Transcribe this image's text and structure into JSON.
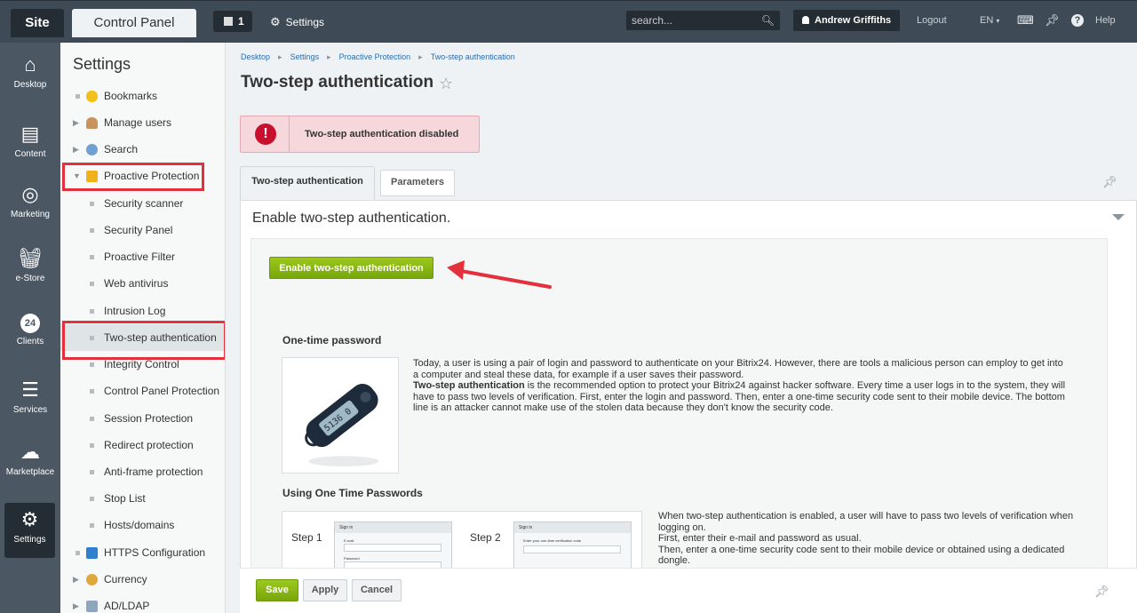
{
  "topbar": {
    "site_label": "Site",
    "control_panel_label": "Control Panel",
    "notifications_count": "1",
    "settings_label": "Settings",
    "search_placeholder": "search...",
    "user_name": "Andrew Griffiths",
    "logout_label": "Logout",
    "lang_label": "EN",
    "help_label": "Help"
  },
  "rail": {
    "items": [
      {
        "label": "Desktop",
        "icon": "home-icon"
      },
      {
        "label": "Content",
        "icon": "document-icon"
      },
      {
        "label": "Marketing",
        "icon": "target-icon"
      },
      {
        "label": "e-Store",
        "icon": "basket-icon"
      },
      {
        "label": "Clients",
        "icon": "clock-24-icon",
        "badge": "24"
      },
      {
        "label": "Services",
        "icon": "layers-icon"
      },
      {
        "label": "Marketplace",
        "icon": "cloud-download-icon"
      },
      {
        "label": "Settings",
        "icon": "gear-icon"
      }
    ]
  },
  "sidebar": {
    "title": "Settings",
    "items": [
      {
        "label": "Bookmarks"
      },
      {
        "label": "Manage users"
      },
      {
        "label": "Search"
      },
      {
        "label": "Proactive Protection"
      },
      {
        "label": "Security scanner"
      },
      {
        "label": "Security Panel"
      },
      {
        "label": "Proactive Filter"
      },
      {
        "label": "Web antivirus"
      },
      {
        "label": "Intrusion Log"
      },
      {
        "label": "Two-step authentication"
      },
      {
        "label": "Integrity Control"
      },
      {
        "label": "Control Panel Protection"
      },
      {
        "label": "Session Protection"
      },
      {
        "label": "Redirect protection"
      },
      {
        "label": "Anti-frame protection"
      },
      {
        "label": "Stop List"
      },
      {
        "label": "Hosts/domains"
      },
      {
        "label": "HTTPS Configuration"
      },
      {
        "label": "Currency"
      },
      {
        "label": "AD/LDAP"
      }
    ]
  },
  "breadcrumb": [
    "Desktop",
    "Settings",
    "Proactive Protection",
    "Two-step authentication"
  ],
  "page_title": "Two-step authentication",
  "alert_text": "Two-step authentication disabled",
  "tabs": [
    {
      "label": "Two-step authentication"
    },
    {
      "label": "Parameters"
    }
  ],
  "panel": {
    "header": "Enable two-step authentication.",
    "enable_button": "Enable two-step authentication",
    "otp_heading": "One-time password",
    "otp_para_1": "Today, a user is using a pair of login and password to authenticate on your Bitrix24. However, there are tools a malicious person can employ to get into a computer and steal these data, for example if a user saves their password.",
    "otp_para_bold": "Two-step authentication",
    "otp_para_2": " is the recommended option to protect your Bitrix24 against hacker software. Every time a user logs in to the system, they will have to pass two levels of verification. First, enter the login and password. Then, enter a one-time security code sent to their mobile device. The bottom line is an attacker cannot make use of the stolen data because they don't know the security code.",
    "token_display": "5136 0",
    "using_heading": "Using One Time Passwords",
    "step1_label": "Step 1",
    "step2_label": "Step 2",
    "card1_title": "Sign in",
    "card1_email": "E-mail",
    "card1_password": "Password",
    "card2_title": "Sign in",
    "card2_prompt": "Enter your one-time verification code",
    "using_para_1": "When two-step authentication is enabled, a user will have to pass two levels of verification when logging on.",
    "using_para_2": "First, enter their e-mail and password as usual.",
    "using_para_3": "Then, enter a one-time security code sent to their mobile device or obtained using a dedicated dongle."
  },
  "footer": {
    "save": "Save",
    "apply": "Apply",
    "cancel": "Cancel"
  },
  "colors": {
    "topbar": "#3e4a55",
    "accent_green": "#78a60b",
    "highlight_red": "#e4303c",
    "link_blue": "#2a6db0"
  }
}
